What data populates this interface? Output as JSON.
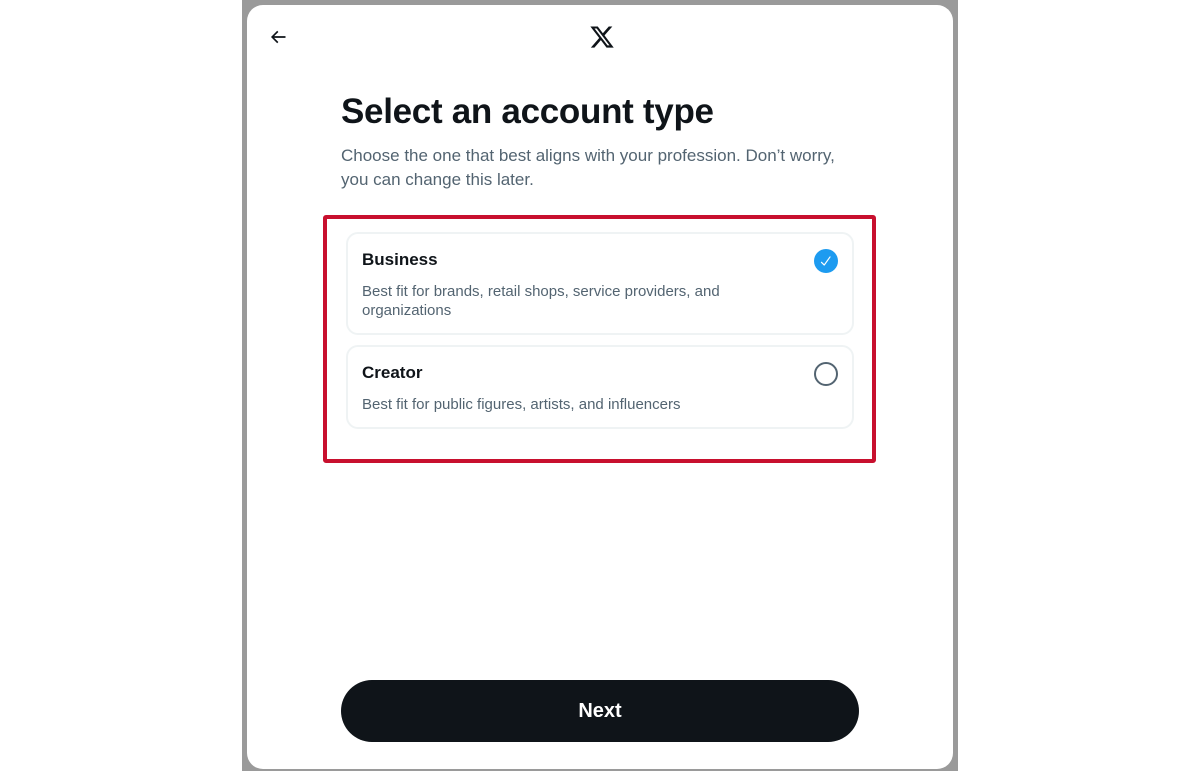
{
  "header": {
    "back_icon": "arrow-left-icon",
    "logo_icon": "x-logo-icon"
  },
  "main": {
    "title": "Select an account type",
    "subtitle": "Choose the one that best aligns with your profession. Don’t worry, you can change this later."
  },
  "options": [
    {
      "title": "Business",
      "description": "Best fit for brands, retail shops, service providers, and organizations",
      "selected": true
    },
    {
      "title": "Creator",
      "description": "Best fit for public figures, artists, and influencers",
      "selected": false
    }
  ],
  "footer": {
    "next_label": "Next"
  },
  "colors": {
    "accent": "#1d9bf0",
    "primary_text": "#0f1419",
    "secondary_text": "#536471",
    "highlight_border": "#c8102e",
    "button_bg": "#0f1419"
  }
}
